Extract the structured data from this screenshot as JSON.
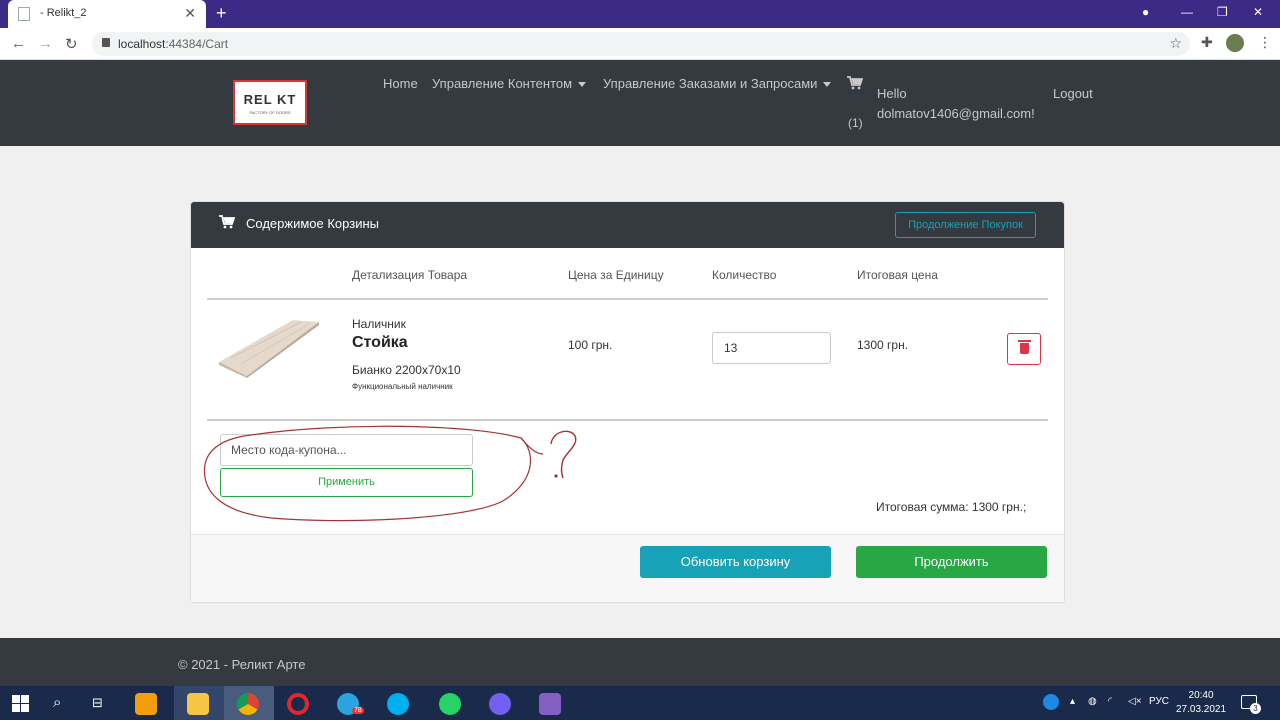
{
  "browser": {
    "tab_title": "- Relikt_2",
    "url_host": "localhost",
    "url_rest": ":44384/Cart"
  },
  "site": {
    "logo_text": "REL KT",
    "logo_sub": "FACTORY OF DOORS",
    "nav": {
      "home": "Home",
      "content": "Управление Контентом",
      "orders": "Управление Заказами и Запросами",
      "cart_count": "(1)",
      "hello_line1": "Hello",
      "hello_line2": "dolmatov1406@gmail.com!",
      "logout": "Logout"
    }
  },
  "cart": {
    "title": "Содержимое Корзины",
    "continue_label": "Продолжение Покупок",
    "columns": {
      "details": "Детализация Товара",
      "unit_price": "Цена за Единицу",
      "quantity": "Количество",
      "total": "Итоговая цена"
    },
    "item": {
      "type": "Наличник",
      "name": "Стойка",
      "variant": "Бианко 2200x70x10",
      "description": "Функциональный наличник",
      "unit_price": "100 грн.",
      "quantity": "13",
      "line_total": "1300 грн."
    },
    "coupon_placeholder": "Место кода-купона...",
    "apply_label": "Применить",
    "grand_total": "Итоговая сумма: 1300 грн.;",
    "update_label": "Обновить корзину",
    "proceed_label": "Продолжить"
  },
  "footer": {
    "copyright": "© 2021 - Реликт Арте"
  },
  "taskbar": {
    "lang": "РУС",
    "time": "20:40",
    "date": "27.03.2021",
    "notif_count": "3",
    "telegram_badge": "78"
  },
  "colors": {
    "header_bg": "#343a40",
    "info": "#17a2b8",
    "success": "#28a745",
    "danger": "#dc3545",
    "annotation": "#a33333"
  },
  "icons": [
    "cart-icon",
    "trash-icon",
    "lock-icon",
    "star-icon",
    "puzzle-icon"
  ]
}
